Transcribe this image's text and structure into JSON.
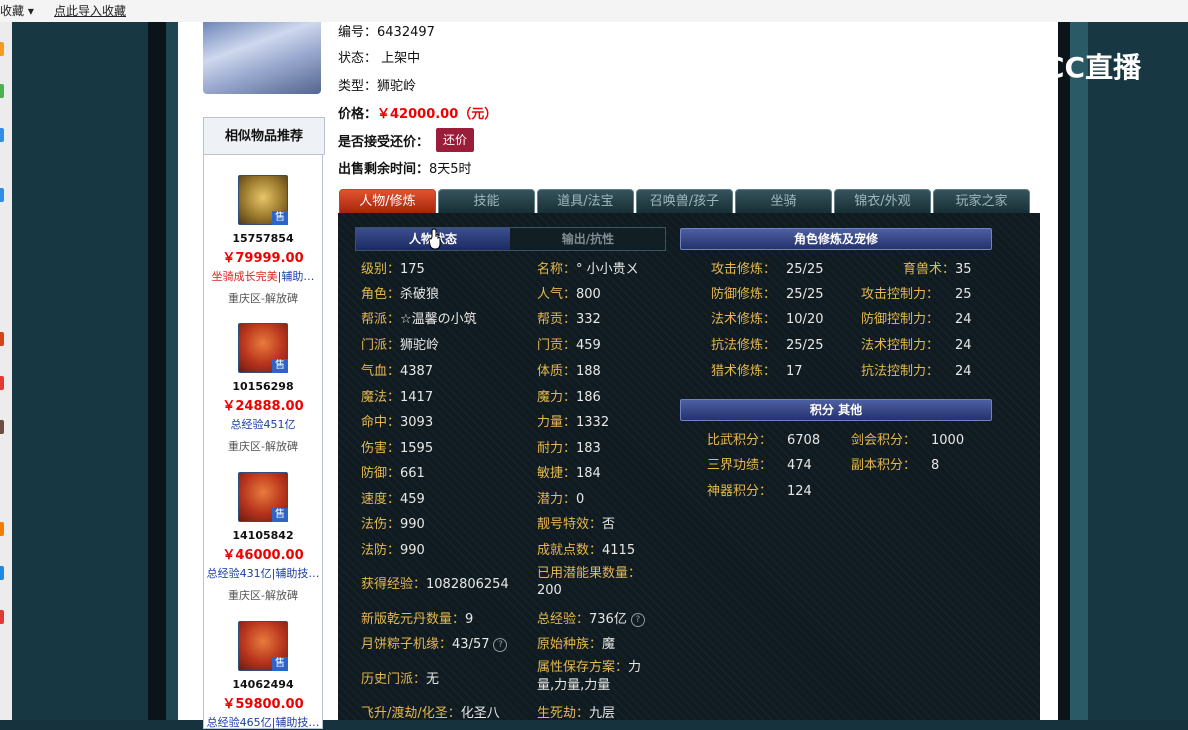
{
  "bookmarks": {
    "left": "收藏",
    "import": "点此导入收藏"
  },
  "item": {
    "id_label": "编号：",
    "id_value": "6432497",
    "status_label": "状态：",
    "status_value": "上架中",
    "type_label": "类型：",
    "type_value": "狮驼岭",
    "price_label": "价格：",
    "price_value": "￥42000.00（元）",
    "haggle_label": "是否接受还价：",
    "haggle_button": "还价",
    "time_label": "出售剩余时间：",
    "time_value": "8天5时"
  },
  "recommend": {
    "title": "相似物品推荐",
    "items": [
      {
        "id": "15757854",
        "price": "￥79999.00",
        "desc_red": "坐骑成长完美",
        "desc": "|辅助…",
        "server": "重庆区-解放碑",
        "sell": "售"
      },
      {
        "id": "10156298",
        "price": "￥24888.00",
        "desc_red": "",
        "desc": "总经验451亿",
        "server": "重庆区-解放碑",
        "sell": "售"
      },
      {
        "id": "14105842",
        "price": "￥46000.00",
        "desc_red": "",
        "desc": "总经验431亿|辅助技…",
        "server": "重庆区-解放碑",
        "sell": "售"
      },
      {
        "id": "14062494",
        "price": "￥59800.00",
        "desc_red": "",
        "desc": "总经验465亿|辅助技…",
        "server": "",
        "sell": "售"
      }
    ]
  },
  "tabs": [
    "人物/修炼",
    "技能",
    "道具/法宝",
    "召唤兽/孩子",
    "坐骑",
    "锦衣/外观",
    "玩家之家"
  ],
  "subtabs": [
    "人物状态",
    "输出/抗性"
  ],
  "left_stats": [
    {
      "k": "级别：",
      "v": "175"
    },
    {
      "k": "角色：",
      "v": "杀破狼"
    },
    {
      "k": "帮派：",
      "v": "☆温馨の小筑"
    },
    {
      "k": "门派：",
      "v": "狮驼岭"
    },
    {
      "k": "气血：",
      "v": "4387"
    },
    {
      "k": "魔法：",
      "v": "1417"
    },
    {
      "k": "命中：",
      "v": "3093"
    },
    {
      "k": "伤害：",
      "v": "1595"
    },
    {
      "k": "防御：",
      "v": "661"
    },
    {
      "k": "速度：",
      "v": "459"
    },
    {
      "k": "法伤：",
      "v": "990"
    },
    {
      "k": "法防：",
      "v": "990"
    },
    {
      "k": "获得经验：",
      "v": "1082806254"
    },
    {
      "k": "新版乾元丹数量：",
      "v": "9"
    },
    {
      "k": "月饼粽子机缘：",
      "v": "43/57"
    },
    {
      "k": "历史门派：",
      "v": "无"
    },
    {
      "k": "飞升/渡劫/化圣：",
      "v": "化圣八"
    }
  ],
  "mid_stats": [
    {
      "k": "名称：",
      "v": "° 小小贵ㄨ"
    },
    {
      "k": "人气：",
      "v": "800"
    },
    {
      "k": "帮贡：",
      "v": "332"
    },
    {
      "k": "门贡：",
      "v": "459"
    },
    {
      "k": "体质：",
      "v": "188"
    },
    {
      "k": "魔力：",
      "v": "186"
    },
    {
      "k": "力量：",
      "v": "1332"
    },
    {
      "k": "耐力：",
      "v": "183"
    },
    {
      "k": "敏捷：",
      "v": "184"
    },
    {
      "k": "潜力：",
      "v": "0"
    },
    {
      "k": "靓号特效：",
      "v": "否"
    },
    {
      "k": "成就点数：",
      "v": "4115"
    },
    {
      "k": "已用潜能果数量：",
      "v": "200"
    },
    {
      "k": "总经验：",
      "v": "736亿"
    },
    {
      "k": "原始种族：",
      "v": "魔"
    },
    {
      "k": "属性保存方案：",
      "v": "力量,力量,力量"
    },
    {
      "k": "生死劫：",
      "v": "九层"
    }
  ],
  "cultivation": {
    "header": "角色修炼及宠修",
    "left": [
      {
        "k": "攻击修炼：",
        "v": "25/25"
      },
      {
        "k": "防御修炼：",
        "v": "25/25"
      },
      {
        "k": "法术修炼：",
        "v": "10/20"
      },
      {
        "k": "抗法修炼：",
        "v": "25/25"
      },
      {
        "k": "猎术修炼：",
        "v": "17"
      }
    ],
    "right": [
      {
        "k": "育兽术：",
        "v": "35"
      },
      {
        "k": "攻击控制力：",
        "v": "25"
      },
      {
        "k": "防御控制力：",
        "v": "24"
      },
      {
        "k": "法术控制力：",
        "v": "24"
      },
      {
        "k": "抗法控制力：",
        "v": "24"
      }
    ]
  },
  "points": {
    "header": "积分 其他",
    "left": [
      {
        "k": "比武积分：",
        "v": "6708"
      },
      {
        "k": "三界功绩：",
        "v": "474"
      },
      {
        "k": "神器积分：",
        "v": "124"
      }
    ],
    "right": [
      {
        "k": "剑会积分：",
        "v": "1000"
      },
      {
        "k": "副本积分：",
        "v": "8"
      }
    ]
  },
  "watermark": "CC直播",
  "colors": {
    "accent_tab": "#c8401e",
    "stat_key": "#e6b84e",
    "price": "#ee0000",
    "haggle": "#9a1e3a"
  }
}
